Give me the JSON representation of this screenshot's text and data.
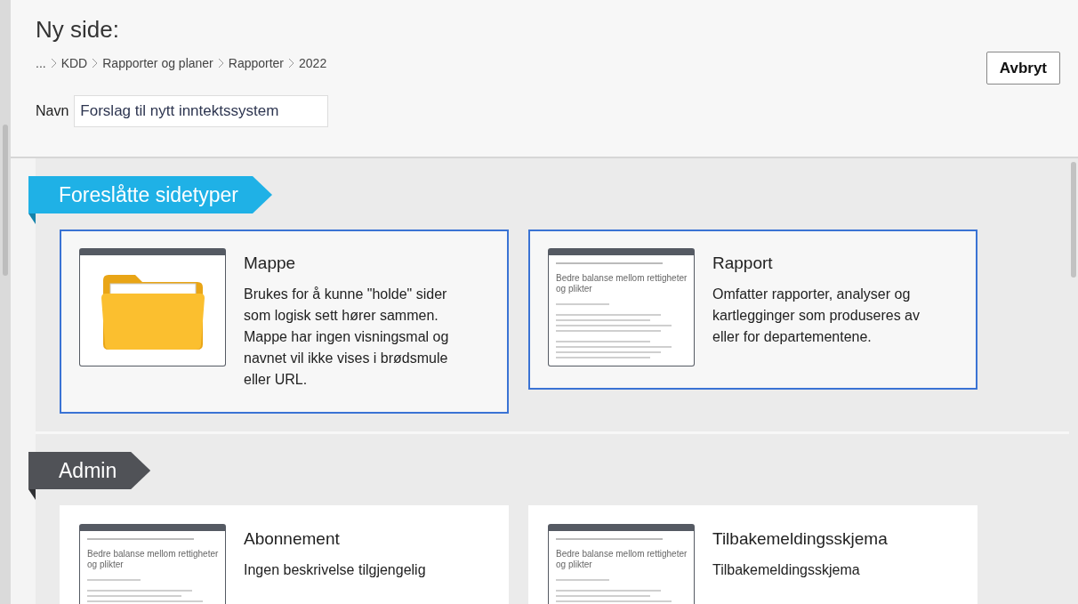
{
  "header": {
    "title": "Ny side:",
    "breadcrumb": [
      "...",
      "KDD",
      "Rapporter og planer",
      "Rapporter",
      "2022"
    ],
    "name_label": "Navn",
    "name_value": "Forslag til nytt inntektssystem",
    "cancel_button": "Avbryt"
  },
  "sections": [
    {
      "title": "Foreslåtte sidetyper",
      "kind": "suggested",
      "cards": [
        {
          "kind": "folder",
          "title": "Mappe",
          "description": "Brukes for å kunne \"holde\" sider som logisk sett hører sammen. Mappe har ingen visningsmal og navnet vil ikke vises i brødsmule eller URL.",
          "selected": true
        },
        {
          "kind": "page",
          "title": "Rapport",
          "description": "Omfatter rapporter, analyser og kartlegginger som produseres av eller for departementene.",
          "thumbnail_heading": "Bedre balanse mellom rettigheter og plikter",
          "selected": true
        }
      ]
    },
    {
      "title": "Admin",
      "kind": "admin",
      "cards": [
        {
          "kind": "page",
          "title": "Abonnement",
          "description": "Ingen beskrivelse tilgjengelig",
          "thumbnail_heading": "Bedre balanse mellom rettigheter og plikter",
          "selected": false
        },
        {
          "kind": "page",
          "title": "Tilbakemeldingsskjema",
          "description": "Tilbakemeldingsskjema",
          "thumbnail_heading": "Bedre balanse mellom rettigheter og plikter",
          "selected": false
        }
      ]
    }
  ]
}
